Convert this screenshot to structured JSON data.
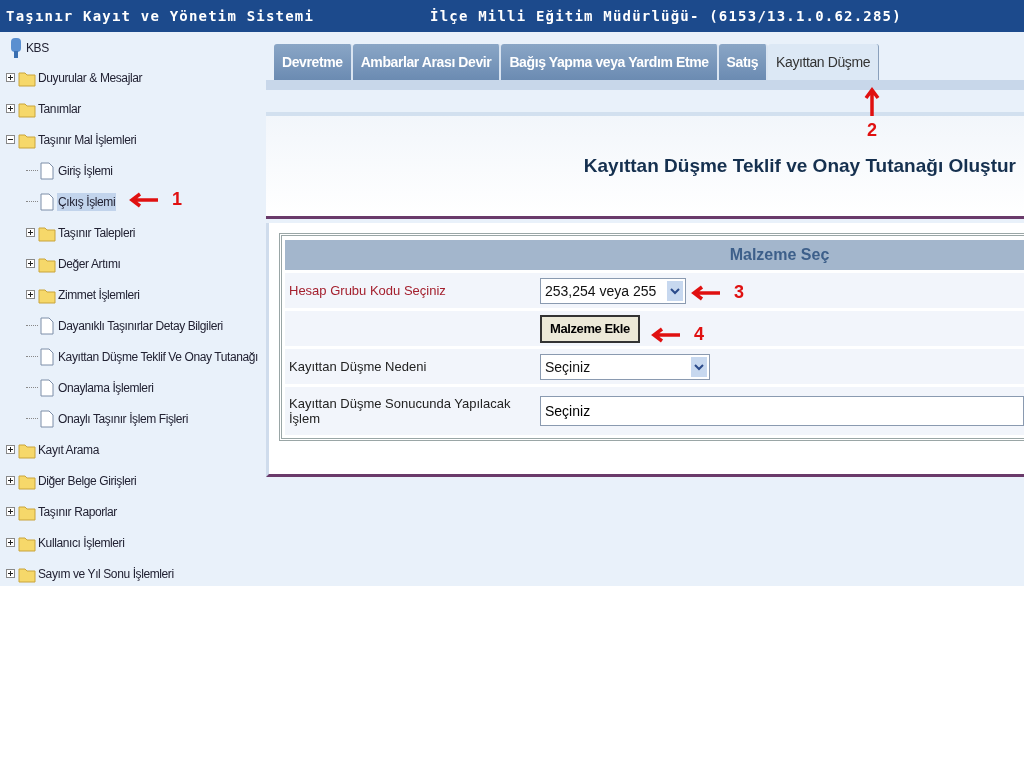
{
  "window": {
    "title": "Taşınır Kayıt ve Yönetim Sistemi",
    "subtitle": "İlçe Milli Eğitim Müdürlüğü- (6153/13.1.0.62.285)"
  },
  "sidebar": {
    "root_label": "KBS",
    "items": [
      {
        "label": "Duyurular & Mesajlar",
        "kind": "folder",
        "expanded": false,
        "selected": false
      },
      {
        "label": "Tanımlar",
        "kind": "folder",
        "expanded": false,
        "selected": false
      },
      {
        "label": "Taşınır Mal İşlemleri",
        "kind": "folder",
        "expanded": true,
        "selected": false,
        "children": [
          {
            "label": "Giriş İşlemi",
            "kind": "file",
            "selected": false
          },
          {
            "label": "Çıkış İşlemi",
            "kind": "file",
            "selected": true
          },
          {
            "label": "Taşınır Talepleri",
            "kind": "folder",
            "expanded": false,
            "selected": false
          },
          {
            "label": "Değer Artımı",
            "kind": "folder",
            "expanded": false,
            "selected": false
          },
          {
            "label": "Zimmet İşlemleri",
            "kind": "folder",
            "expanded": false,
            "selected": false
          },
          {
            "label": "Dayanıklı Taşınırlar Detay Bilgileri",
            "kind": "file",
            "selected": false
          },
          {
            "label": "Kayıttan Düşme Teklif Ve Onay Tutanağı",
            "kind": "file",
            "selected": false
          },
          {
            "label": "Onaylama İşlemleri",
            "kind": "file",
            "selected": false
          },
          {
            "label": "Onaylı Taşınır İşlem Fişleri",
            "kind": "file",
            "selected": false
          }
        ]
      },
      {
        "label": "Kayıt Arama",
        "kind": "folder",
        "expanded": false,
        "selected": false
      },
      {
        "label": "Diğer Belge Girişleri",
        "kind": "folder",
        "expanded": false,
        "selected": false
      },
      {
        "label": "Taşınır Raporlar",
        "kind": "folder",
        "expanded": false,
        "selected": false
      },
      {
        "label": "Kullanıcı İşlemleri",
        "kind": "folder",
        "expanded": false,
        "selected": false
      },
      {
        "label": "Sayım ve Yıl Sonu İşlemleri",
        "kind": "folder",
        "expanded": false,
        "selected": false
      }
    ]
  },
  "tabs": [
    {
      "label": "Devretme",
      "selected": false
    },
    {
      "label": "Ambarlar Arası Devir",
      "selected": false
    },
    {
      "label": "Bağış Yapma veya Yardım Etme",
      "selected": false
    },
    {
      "label": "Satış",
      "selected": false
    },
    {
      "label": "Kayıttan Düşme",
      "selected": true
    }
  ],
  "page_title": "Kayıttan Düşme Teklif ve Onay Tutanağı Oluştur",
  "form": {
    "header": "Malzeme Seç",
    "rows": [
      {
        "kind": "select",
        "label": "Hesap Grubu Kodu Seçiniz",
        "required": true,
        "value": "253,254 veya 255"
      },
      {
        "kind": "button",
        "label": "Malzeme Ekle"
      },
      {
        "kind": "select",
        "label": "Kayıttan Düşme Nedeni",
        "required": false,
        "value": "Seçiniz"
      },
      {
        "kind": "wide",
        "label": "Kayıttan Düşme Sonucunda Yapılacak İşlem",
        "required": false,
        "value": "Seçiniz"
      }
    ]
  },
  "annotations": [
    {
      "label": "1",
      "kind": "left"
    },
    {
      "label": "2",
      "kind": "up"
    },
    {
      "label": "3",
      "kind": "left"
    },
    {
      "label": "4",
      "kind": "left"
    }
  ]
}
